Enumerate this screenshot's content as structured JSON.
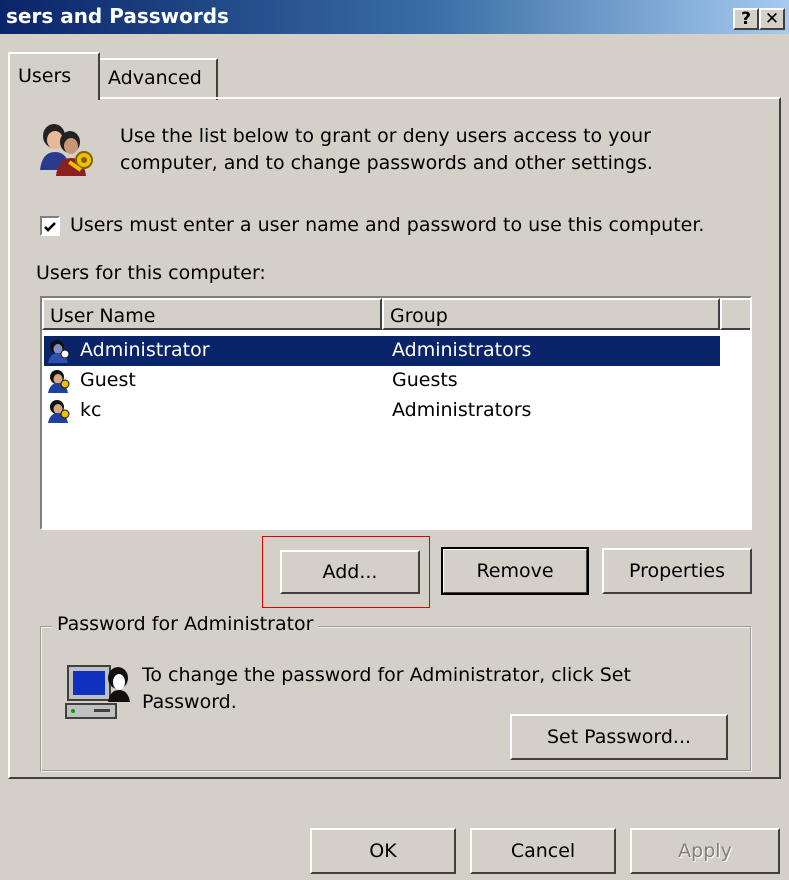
{
  "window": {
    "title": "Users and Passwords",
    "title_visible": "sers and Passwords",
    "help_button": "?",
    "close_button": "✕"
  },
  "tabs": [
    {
      "label": "Users",
      "selected": true
    },
    {
      "label": "Advanced",
      "selected": false
    }
  ],
  "intro_text": "Use the list below to grant or deny users access to your computer, and to change passwords and other settings.",
  "require_login": {
    "label": "Users must enter a user name and password to use this computer.",
    "checked": true
  },
  "users_label": "Users for this computer:",
  "users_table": {
    "columns": [
      "User Name",
      "Group"
    ],
    "rows": [
      {
        "name": "Administrator",
        "group": "Administrators",
        "selected": true
      },
      {
        "name": "Guest",
        "group": "Guests",
        "selected": false
      },
      {
        "name": "kc",
        "group": "Administrators",
        "selected": false
      }
    ]
  },
  "buttons": {
    "add": "Add...",
    "remove": "Remove",
    "properties": "Properties",
    "set_password": "Set Password...",
    "ok": "OK",
    "cancel": "Cancel",
    "apply": "Apply"
  },
  "password_group": {
    "title": "Password for Administrator",
    "text": "To change the password for Administrator, click Set Password."
  },
  "colors": {
    "dialog_bg": "#d4d0c8",
    "selection": "#0a246a",
    "titlebar_start": "#0a246a",
    "annotation_box": "#e00000"
  }
}
